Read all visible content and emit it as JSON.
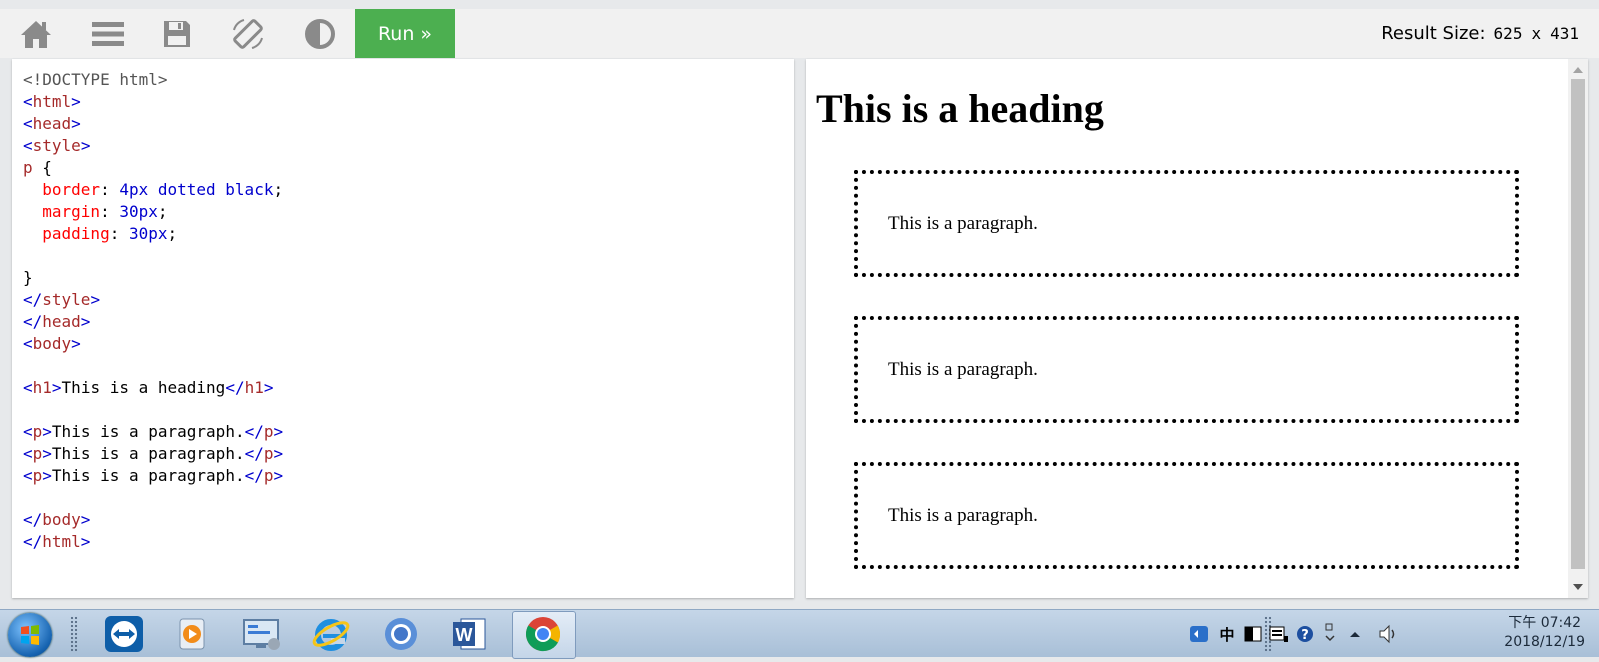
{
  "toolbar": {
    "icons": [
      "home-icon",
      "menu-icon",
      "save-icon",
      "rotate-screen-icon",
      "contrast-icon"
    ],
    "run_label": "Run »",
    "result_size_label": "Result Size:",
    "result_width": "625",
    "result_x": "x",
    "result_height": "431"
  },
  "code": {
    "doctype": "<!DOCTYPE html>",
    "lines": {
      "html_open": "html",
      "head_open": "head",
      "style_open": "style",
      "selector": "p",
      "brace_open": "{",
      "prop1": "border",
      "val1": "4px dotted black",
      "prop2": "margin",
      "val2": "30px",
      "prop3": "padding",
      "val3": "30px",
      "brace_close": "}",
      "style_close": "style",
      "head_close": "head",
      "body_open": "body",
      "h1_tag": "h1",
      "h1_text": "This is a heading",
      "p_tag": "p",
      "p_text": "This is a paragraph.",
      "body_close": "body",
      "html_close": "html"
    }
  },
  "result": {
    "heading": "This is a heading",
    "paragraphs": [
      "This is a paragraph.",
      "This is a paragraph.",
      "This is a paragraph."
    ]
  },
  "taskbar": {
    "apps": [
      "teamviewer-icon",
      "media-player-icon",
      "remote-desktop-icon",
      "internet-explorer-icon",
      "chromium-icon",
      "word-icon",
      "chrome-icon"
    ],
    "clock_time": "下午 07:42",
    "clock_date": "2018/12/19",
    "colors": {
      "run": "#4caf50",
      "toolbar": "#f1f1f1"
    }
  }
}
